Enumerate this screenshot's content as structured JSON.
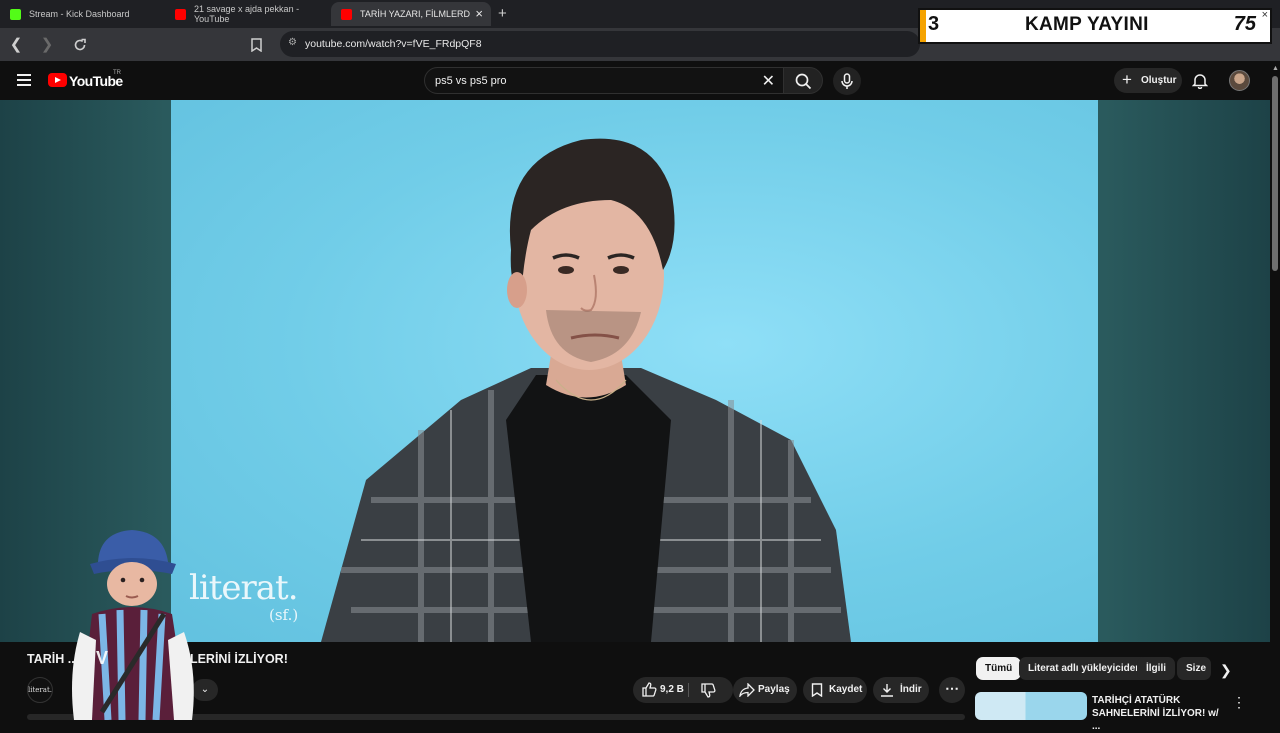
{
  "browser": {
    "tabs": [
      {
        "label": "Stream - Kick Dashboard",
        "favicon_color": "#53fc18"
      },
      {
        "label": "21 savage x ajda pekkan - YouTube",
        "favicon_color": "#ff0000"
      },
      {
        "label": "TARİH YAZARI, FİLMLERDEKİ",
        "favicon_color": "#ff0000"
      }
    ],
    "url": "youtube.com/watch?v=fVE_FRdpQF8"
  },
  "overlay": {
    "left_number": "3",
    "title": "KAMP YAYINI",
    "right_number": "75"
  },
  "youtube": {
    "logo_text": "YouTube",
    "country_code": "TR",
    "search_query": "ps5 vs ps5 pro",
    "create_label": "Oluştur"
  },
  "video": {
    "watermark": "literat.",
    "watermark_sub": "(sf.)",
    "title": "TARİH ... Kİ HİTLER SAHNELERİNİ İZLİYOR!",
    "channel_icon_text": "literat."
  },
  "actions": {
    "like_count": "9,2 B",
    "share_label": "Paylaş",
    "save_label": "Kaydet",
    "download_label": "İndir"
  },
  "chips": [
    "Tümü",
    "Literat adlı yükleyiciden",
    "İlgili",
    "Size"
  ],
  "related": [
    {
      "title": "TARİHÇİ ATATÜRK SAHNELERİNİ İZLİYOR! w/ ..."
    }
  ],
  "colors": {
    "brand_red": "#ff0000",
    "overlay_accent": "#f5a300"
  }
}
